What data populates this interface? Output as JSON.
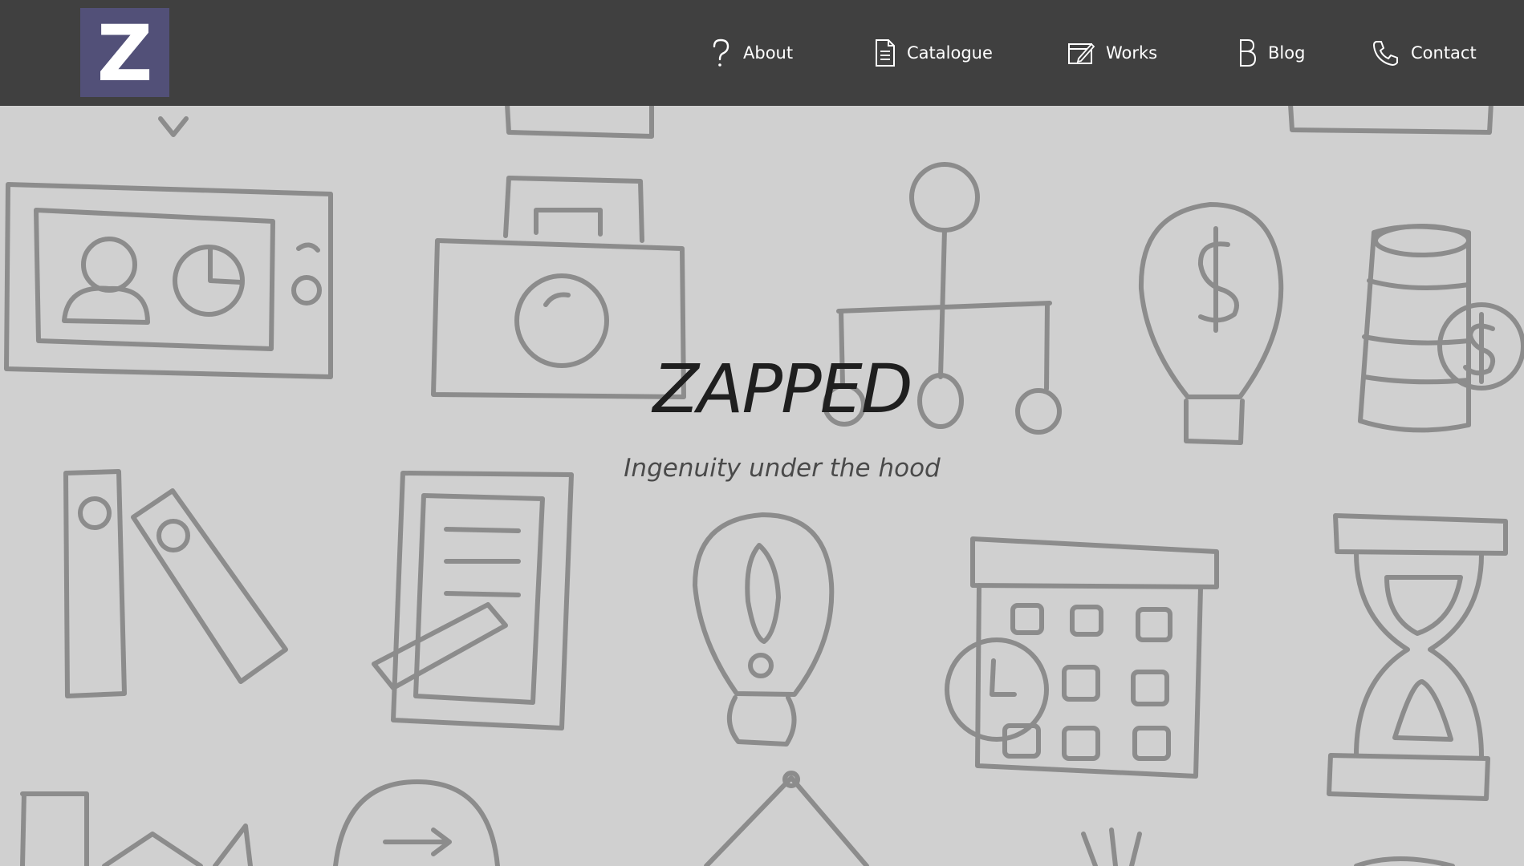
{
  "site": {
    "logo_letter": "Z",
    "brand_color": "#525078",
    "header_bg": "#404040",
    "page_bg": "#d0d0d0"
  },
  "nav": {
    "items": [
      {
        "label": "About",
        "icon": "question-mark-icon"
      },
      {
        "label": "Catalogue",
        "icon": "document-icon"
      },
      {
        "label": "Works",
        "icon": "edit-window-icon"
      },
      {
        "label": "Blog",
        "icon": "blog-b-icon"
      },
      {
        "label": "Contact",
        "icon": "phone-icon"
      }
    ]
  },
  "hero": {
    "title": "ZAPPED",
    "subtitle": "Ingenuity under the hood"
  }
}
